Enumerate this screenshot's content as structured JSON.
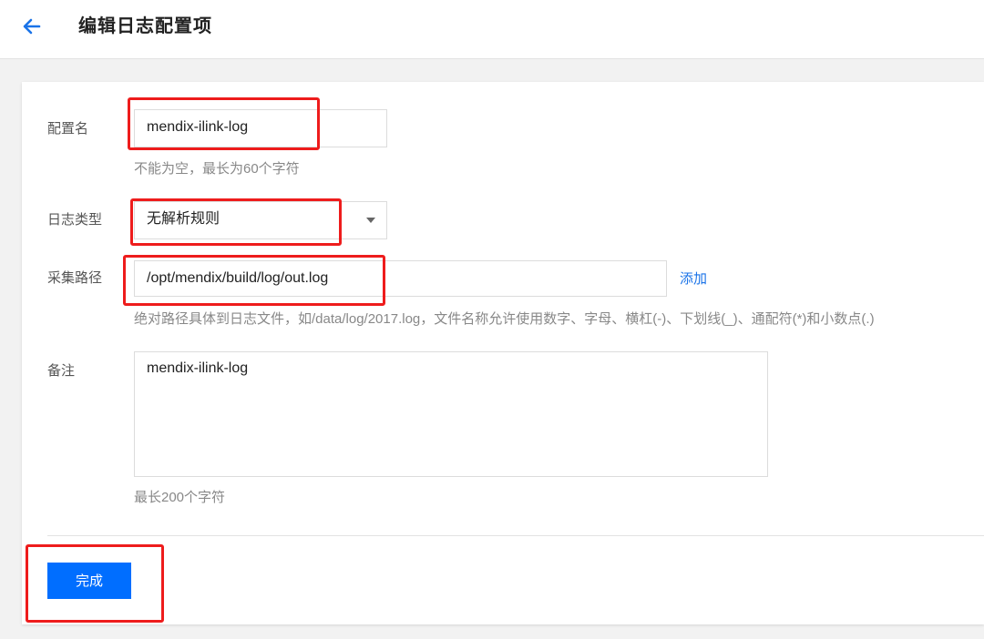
{
  "header": {
    "title": "编辑日志配置项",
    "back_icon": "arrow-left-icon"
  },
  "colors": {
    "accent": "#006eff",
    "link": "#1a73e8",
    "highlight": "#ee1c1c"
  },
  "form": {
    "config_name": {
      "label": "配置名",
      "value": "mendix-ilink-log",
      "hint": "不能为空，最长为60个字符"
    },
    "log_type": {
      "label": "日志类型",
      "value": "无解析规则"
    },
    "collect_path": {
      "label": "采集路径",
      "value": "/opt/mendix/build/log/out.log",
      "add_label": "添加",
      "hint": "绝对路径具体到日志文件，如/data/log/2017.log，文件名称允许使用数字、字母、横杠(-)、下划线(_)、通配符(*)和小数点(.)"
    },
    "remark": {
      "label": "备注",
      "value": "mendix-ilink-log",
      "hint": "最长200个字符"
    }
  },
  "footer": {
    "submit_label": "完成"
  }
}
